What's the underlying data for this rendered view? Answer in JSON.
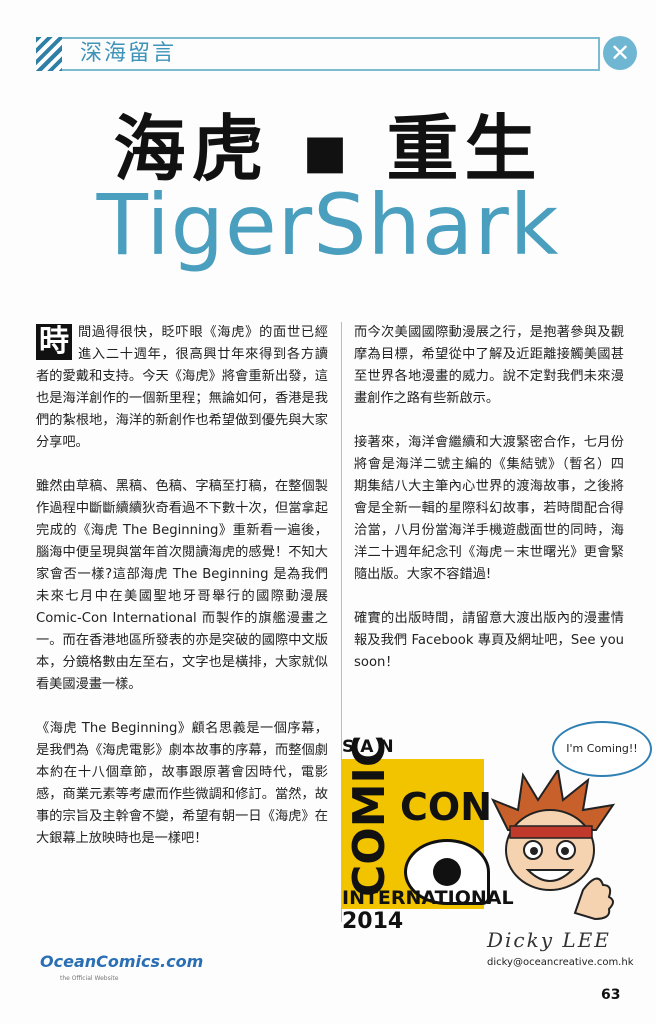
{
  "header": {
    "section_label": "深海留言",
    "close_glyph": "✕"
  },
  "title": {
    "zh": "海虎 ▪ 重生",
    "en": "TigerShark"
  },
  "article": {
    "dropcap": "時",
    "left": [
      "間過得很快，眨吓眼《海虎》的面世已經進入二十週年，很高興廿年來得到各方讀者的愛戴和支持。今天《海虎》將會重新出發，這也是海洋創作的一個新里程；無論如何，香港是我們的紮根地，海洋的新創作也希望做到優先與大家分享吧。",
      "雖然由草稿、黑稿、色稿、字稿至打稿，在整個製作過程中斷斷續續狄奇看過不下數十次，但當拿起完成的《海虎 The Beginning》重新看一遍後，腦海中便呈現與當年首次閱讀海虎的感覺！不知大家會否一樣?這部海虎 The Beginning 是為我們未來七月中在美國聖地牙哥舉行的國際動漫展 Comic-Con International 而製作的旗艦漫畫之一。而在香港地區所發表的亦是突破的國際中文版本，分鏡格數由左至右，文字也是橫排，大家就似看美國漫畫一樣。",
      "《海虎 The Beginning》顧名思義是一個序幕，是我們為《海虎電影》劇本故事的序幕，而整個劇本約在十八個章節，故事跟原著會因時代，電影感，商業元素等考慮而作些微調和修訂。當然，故事的宗旨及主幹會不變，希望有朝一日《海虎》在大銀幕上放映時也是一樣吧！"
    ],
    "right": [
      "而今次美國國際動漫展之行，是抱著參與及觀摩為目標，希望從中了解及近距離接觸美國甚至世界各地漫畫的威力。說不定對我們未來漫畫創作之路有些新啟示。",
      "接著來，海洋會繼續和大渡緊密合作，七月份將會是海洋二號主編的《集結號》（暫名）四期集結八大主筆內心世界的渡海故事，之後將會是全新一輯的星際科幻故事，若時間配合得洽當，八月份當海洋手機遊戲面世的同時，海洋二十週年紀念刊《海虎－末世曙光》更會緊隨出版。大家不容錯過!",
      "確實的出版時間，請留意大渡出版內的漫畫情報及我們 Facebook 專頁及網址吧，See you soon！"
    ]
  },
  "logo": {
    "city": "SAN DIEGO",
    "comic": "COMIC",
    "con": "CON",
    "international": "INTERNATIONAL",
    "year": "2014"
  },
  "bubble": "I'm Coming!!",
  "signature": "Dicky LEE",
  "email": "dicky@oceancreative.com.hk",
  "brand": {
    "name": "OceanComics.com",
    "sub": "the Official Website"
  },
  "page_number": "63",
  "colors": {
    "accent": "#4a9fbf",
    "stripe": "#2f7fa6",
    "logo_yellow": "#f2c400"
  }
}
